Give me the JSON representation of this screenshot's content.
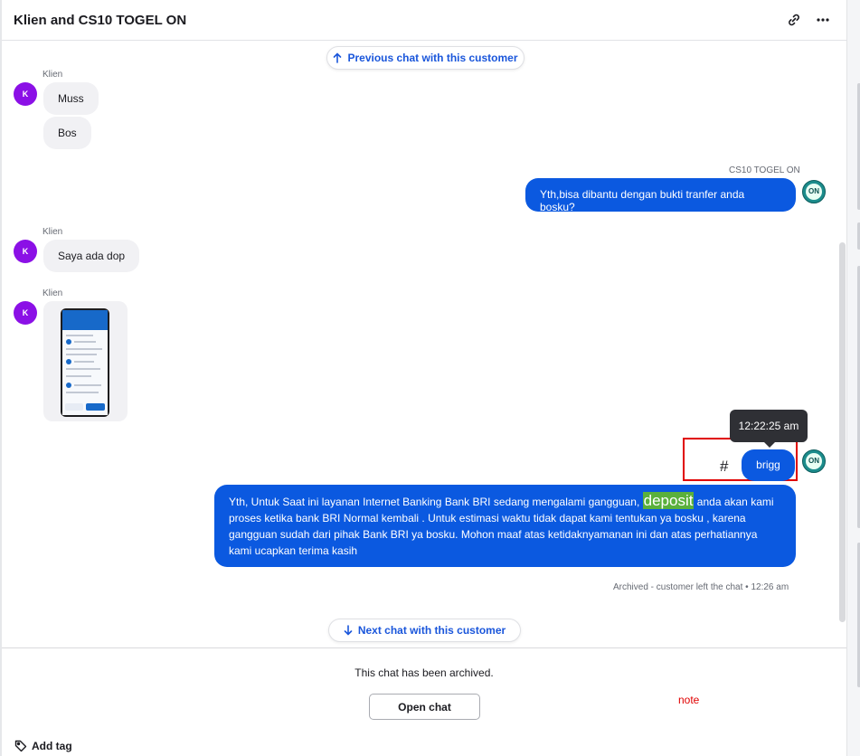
{
  "header": {
    "title": "Klien and CS10 TOGEL ON",
    "link_icon": "link-icon",
    "more_icon": "more-horizontal-icon"
  },
  "nav": {
    "previous_label": "Previous chat with this customer",
    "next_label": "Next chat with this customer"
  },
  "messages": {
    "customer_name": "Klien",
    "customer_initial": "K",
    "agent_name": "CS10 TOGEL ON",
    "agent_initials": "ON",
    "m1": "Muss",
    "m2": "Bos",
    "m3": "Yth,bisa dibantu dengan bukti tranfer anda bosku?",
    "m4": "Saya ada dop",
    "m5": "brigg",
    "m6_before": "Yth, Untuk Saat ini layanan Internet Banking Bank BRI sedang mengalami gangguan, ",
    "m6_highlight": "deposit",
    "m6_after": " anda akan kami proses ketika bank BRI Normal kembali . Untuk estimasi waktu tidak dapat kami tentukan ya bosku , karena gangguan sudah dari pihak Bank BRI ya bosku. Mohon maaf atas ketidaknyamanan ini dan atas perhatiannya kami ucapkan terima kasih",
    "tooltip_time": "12:22:25 am",
    "hash_symbol": "#",
    "archived_meta": "Archived - customer left the chat • 12:26 am"
  },
  "footer": {
    "archived_text": "This chat has been archived.",
    "open_chat_label": "Open chat",
    "note_label": "note",
    "add_tag_label": "Add tag"
  },
  "colors": {
    "accent": "#0b59e0",
    "customer_avatar": "#8b10e6",
    "highlight": "#5ab03c",
    "annotation": "#e00000"
  }
}
